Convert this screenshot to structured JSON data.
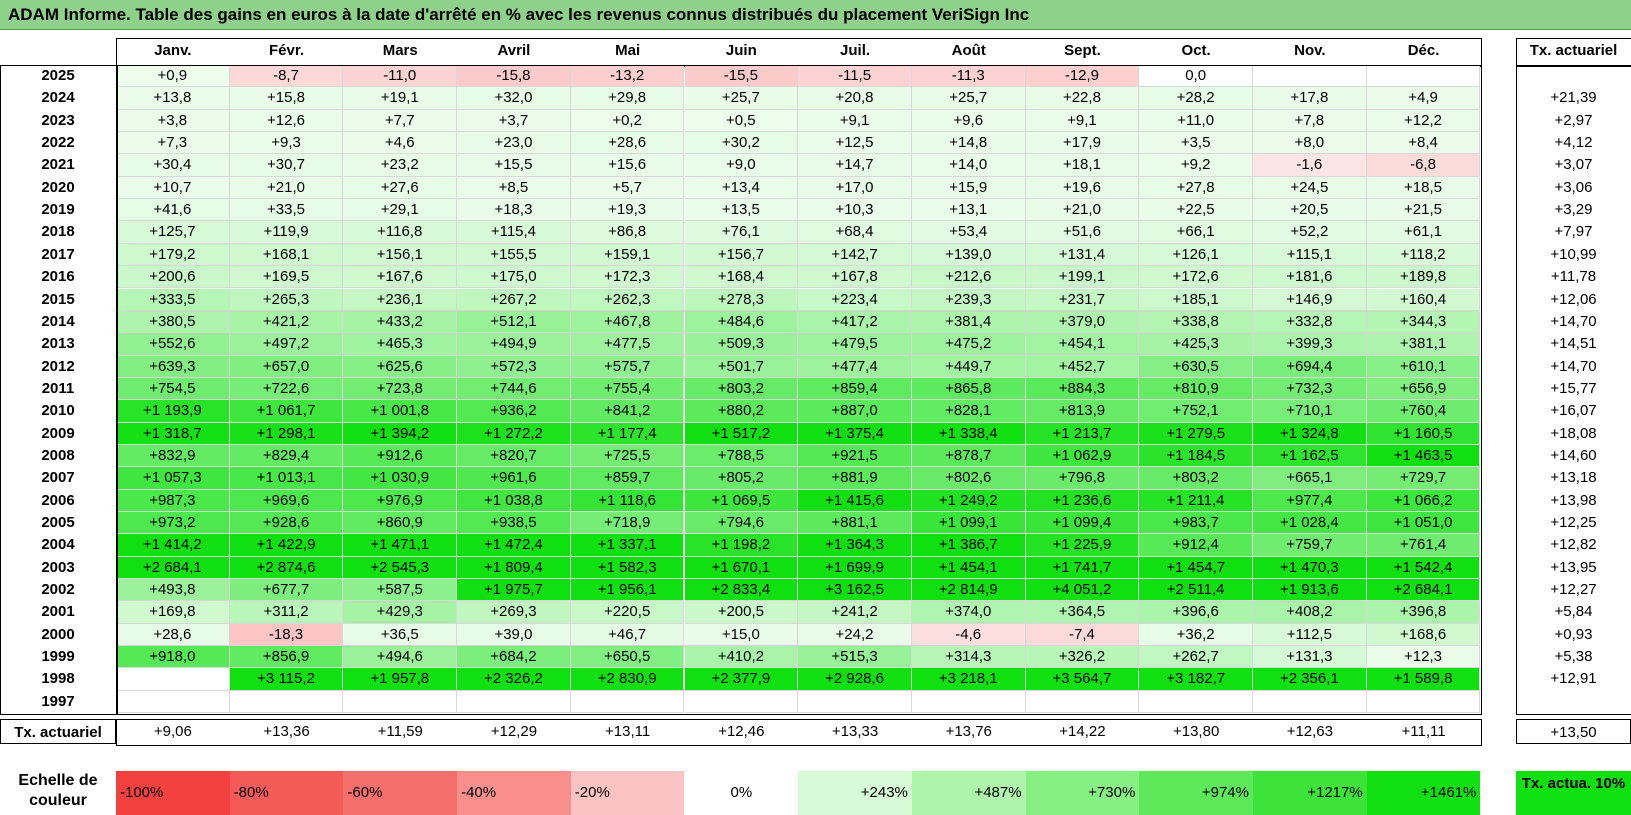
{
  "title": "ADAM Informe. Table des gains en euros à la date d'arrêté en % avec les revenus connus distribués du placement VeriSign Inc",
  "chart_data": {
    "type": "table",
    "months": [
      "Janv.",
      "Févr.",
      "Mars",
      "Avril",
      "Mai",
      "Juin",
      "Juil.",
      "Août",
      "Sept.",
      "Oct.",
      "Nov.",
      "Déc."
    ],
    "tx_header": "Tx. actuariel",
    "rows": [
      {
        "year": "2025",
        "values": [
          "+0,9",
          "-8,7",
          "-11,0",
          "-15,8",
          "-13,2",
          "-15,5",
          "-11,5",
          "-11,3",
          "-12,9",
          "0,0",
          "",
          ""
        ],
        "tx": ""
      },
      {
        "year": "2024",
        "values": [
          "+13,8",
          "+15,8",
          "+19,1",
          "+32,0",
          "+29,8",
          "+25,7",
          "+20,8",
          "+25,7",
          "+22,8",
          "+28,2",
          "+17,8",
          "+4,9"
        ],
        "tx": "+21,39"
      },
      {
        "year": "2023",
        "values": [
          "+3,8",
          "+12,6",
          "+7,7",
          "+3,7",
          "+0,2",
          "+0,5",
          "+9,1",
          "+9,6",
          "+9,1",
          "+11,0",
          "+7,8",
          "+12,2"
        ],
        "tx": "+2,97"
      },
      {
        "year": "2022",
        "values": [
          "+7,3",
          "+9,3",
          "+4,6",
          "+23,0",
          "+28,6",
          "+30,2",
          "+12,5",
          "+14,8",
          "+17,9",
          "+3,5",
          "+8,0",
          "+8,4"
        ],
        "tx": "+4,12"
      },
      {
        "year": "2021",
        "values": [
          "+30,4",
          "+30,7",
          "+23,2",
          "+15,5",
          "+15,6",
          "+9,0",
          "+14,7",
          "+14,0",
          "+18,1",
          "+9,2",
          "-1,6",
          "-6,8"
        ],
        "tx": "+3,07"
      },
      {
        "year": "2020",
        "values": [
          "+10,7",
          "+21,0",
          "+27,6",
          "+8,5",
          "+5,7",
          "+13,4",
          "+17,0",
          "+15,9",
          "+19,6",
          "+27,8",
          "+24,5",
          "+18,5"
        ],
        "tx": "+3,06"
      },
      {
        "year": "2019",
        "values": [
          "+41,6",
          "+33,5",
          "+29,1",
          "+18,3",
          "+19,3",
          "+13,5",
          "+10,3",
          "+13,1",
          "+21,0",
          "+22,5",
          "+20,5",
          "+21,5"
        ],
        "tx": "+3,29"
      },
      {
        "year": "2018",
        "values": [
          "+125,7",
          "+119,9",
          "+116,8",
          "+115,4",
          "+86,8",
          "+76,1",
          "+68,4",
          "+53,4",
          "+51,6",
          "+66,1",
          "+52,2",
          "+61,1"
        ],
        "tx": "+7,97"
      },
      {
        "year": "2017",
        "values": [
          "+179,2",
          "+168,1",
          "+156,1",
          "+155,5",
          "+159,1",
          "+156,7",
          "+142,7",
          "+139,0",
          "+131,4",
          "+126,1",
          "+115,1",
          "+118,2"
        ],
        "tx": "+10,99"
      },
      {
        "year": "2016",
        "values": [
          "+200,6",
          "+169,5",
          "+167,6",
          "+175,0",
          "+172,3",
          "+168,4",
          "+167,8",
          "+212,6",
          "+199,1",
          "+172,6",
          "+181,6",
          "+189,8"
        ],
        "tx": "+11,78"
      },
      {
        "year": "2015",
        "values": [
          "+333,5",
          "+265,3",
          "+236,1",
          "+267,2",
          "+262,3",
          "+278,3",
          "+223,4",
          "+239,3",
          "+231,7",
          "+185,1",
          "+146,9",
          "+160,4"
        ],
        "tx": "+12,06"
      },
      {
        "year": "2014",
        "values": [
          "+380,5",
          "+421,2",
          "+433,2",
          "+512,1",
          "+467,8",
          "+484,6",
          "+417,2",
          "+381,4",
          "+379,0",
          "+338,8",
          "+332,8",
          "+344,3"
        ],
        "tx": "+14,70"
      },
      {
        "year": "2013",
        "values": [
          "+552,6",
          "+497,2",
          "+465,3",
          "+494,9",
          "+477,5",
          "+509,3",
          "+479,5",
          "+475,2",
          "+454,1",
          "+425,3",
          "+399,3",
          "+381,1"
        ],
        "tx": "+14,51"
      },
      {
        "year": "2012",
        "values": [
          "+639,3",
          "+657,0",
          "+625,6",
          "+572,3",
          "+575,7",
          "+501,7",
          "+477,4",
          "+449,7",
          "+452,7",
          "+630,5",
          "+694,4",
          "+610,1"
        ],
        "tx": "+14,70"
      },
      {
        "year": "2011",
        "values": [
          "+754,5",
          "+722,6",
          "+723,8",
          "+744,6",
          "+755,4",
          "+803,2",
          "+859,4",
          "+865,8",
          "+884,3",
          "+810,9",
          "+732,3",
          "+656,9"
        ],
        "tx": "+15,77"
      },
      {
        "year": "2010",
        "values": [
          "+1 193,9",
          "+1 061,7",
          "+1 001,8",
          "+936,2",
          "+841,2",
          "+880,2",
          "+887,0",
          "+828,1",
          "+813,9",
          "+752,1",
          "+710,1",
          "+760,4"
        ],
        "tx": "+16,07"
      },
      {
        "year": "2009",
        "values": [
          "+1 318,7",
          "+1 298,1",
          "+1 394,2",
          "+1 272,2",
          "+1 177,4",
          "+1 517,2",
          "+1 375,4",
          "+1 338,4",
          "+1 213,7",
          "+1 279,5",
          "+1 324,8",
          "+1 160,5"
        ],
        "tx": "+18,08"
      },
      {
        "year": "2008",
        "values": [
          "+832,9",
          "+829,4",
          "+912,6",
          "+820,7",
          "+725,5",
          "+788,5",
          "+921,5",
          "+878,7",
          "+1 062,9",
          "+1 184,5",
          "+1 162,5",
          "+1 463,5"
        ],
        "tx": "+14,60"
      },
      {
        "year": "2007",
        "values": [
          "+1 057,3",
          "+1 013,1",
          "+1 030,9",
          "+961,6",
          "+859,7",
          "+805,2",
          "+881,9",
          "+802,6",
          "+796,8",
          "+803,2",
          "+665,1",
          "+729,7"
        ],
        "tx": "+13,18"
      },
      {
        "year": "2006",
        "values": [
          "+987,3",
          "+969,6",
          "+976,9",
          "+1 038,8",
          "+1 118,6",
          "+1 069,5",
          "+1 415,6",
          "+1 249,2",
          "+1 236,6",
          "+1 211,4",
          "+977,4",
          "+1 066,2"
        ],
        "tx": "+13,98"
      },
      {
        "year": "2005",
        "values": [
          "+973,2",
          "+928,6",
          "+860,9",
          "+938,5",
          "+718,9",
          "+794,6",
          "+881,1",
          "+1 099,1",
          "+1 099,4",
          "+983,7",
          "+1 028,4",
          "+1 051,0"
        ],
        "tx": "+12,25"
      },
      {
        "year": "2004",
        "values": [
          "+1 414,2",
          "+1 422,9",
          "+1 471,1",
          "+1 472,4",
          "+1 337,1",
          "+1 198,2",
          "+1 364,3",
          "+1 386,7",
          "+1 225,9",
          "+912,4",
          "+759,7",
          "+761,4"
        ],
        "tx": "+12,82"
      },
      {
        "year": "2003",
        "values": [
          "+2 684,1",
          "+2 874,6",
          "+2 545,3",
          "+1 809,4",
          "+1 582,3",
          "+1 670,1",
          "+1 699,9",
          "+1 454,1",
          "+1 741,7",
          "+1 454,7",
          "+1 470,3",
          "+1 542,4"
        ],
        "tx": "+13,95"
      },
      {
        "year": "2002",
        "values": [
          "+493,8",
          "+677,7",
          "+587,5",
          "+1 975,7",
          "+1 956,1",
          "+2 833,4",
          "+3 162,5",
          "+2 814,9",
          "+4 051,2",
          "+2 511,4",
          "+1 913,6",
          "+2 684,1"
        ],
        "tx": "+12,27"
      },
      {
        "year": "2001",
        "values": [
          "+169,8",
          "+311,2",
          "+429,3",
          "+269,3",
          "+220,5",
          "+200,5",
          "+241,2",
          "+374,0",
          "+364,5",
          "+396,6",
          "+408,2",
          "+396,8"
        ],
        "tx": "+5,84"
      },
      {
        "year": "2000",
        "values": [
          "+28,6",
          "-18,3",
          "+36,5",
          "+39,0",
          "+46,7",
          "+15,0",
          "+24,2",
          "-4,6",
          "-7,4",
          "+36,2",
          "+112,5",
          "+168,6"
        ],
        "tx": "+0,93"
      },
      {
        "year": "1999",
        "values": [
          "+918,0",
          "+856,9",
          "+494,6",
          "+684,2",
          "+650,5",
          "+410,2",
          "+515,3",
          "+314,3",
          "+326,2",
          "+262,7",
          "+131,3",
          "+12,3"
        ],
        "tx": "+5,38"
      },
      {
        "year": "1998",
        "values": [
          "",
          "+3 115,2",
          "+1 957,8",
          "+2 326,2",
          "+2 830,9",
          "+2 377,9",
          "+2 928,6",
          "+3 218,1",
          "+3 564,7",
          "+3 182,7",
          "+2 356,1",
          "+1 589,8"
        ],
        "tx": "+12,91"
      },
      {
        "year": "1997",
        "values": [
          "",
          "",
          "",
          "",
          "",
          "",
          "",
          "",
          "",
          "",
          "",
          ""
        ],
        "tx": ""
      }
    ],
    "footer": {
      "label": "Tx. actuariel",
      "values": [
        "+9,06",
        "+13,36",
        "+11,59",
        "+12,29",
        "+13,11",
        "+12,46",
        "+13,33",
        "+13,76",
        "+14,22",
        "+13,80",
        "+12,63",
        "+11,11"
      ],
      "tx": "+13,50"
    },
    "scale": {
      "label": "Echelle de couleur",
      "items": [
        {
          "text": "-100%",
          "color": "#f2413f",
          "align": "left"
        },
        {
          "text": "-80%",
          "color": "#f45a57",
          "align": "left"
        },
        {
          "text": "-60%",
          "color": "#f56f6c",
          "align": "left"
        },
        {
          "text": "-40%",
          "color": "#f88f8c",
          "align": "left"
        },
        {
          "text": "-20%",
          "color": "#fbc3c1",
          "align": "left"
        },
        {
          "text": "0%",
          "color": "#ffffff",
          "align": "center"
        },
        {
          "text": "+243%",
          "color": "#d6fbd6",
          "align": "right"
        },
        {
          "text": "+487%",
          "color": "#aef5ab",
          "align": "right"
        },
        {
          "text": "+730%",
          "color": "#86f082",
          "align": "right"
        },
        {
          "text": "+974%",
          "color": "#5de95a",
          "align": "right"
        },
        {
          "text": "+1217%",
          "color": "#3ee33a",
          "align": "right"
        },
        {
          "text": "+1461%",
          "color": "#10e010",
          "align": "right"
        }
      ],
      "tx_label": "Tx. actua. 10%"
    }
  }
}
